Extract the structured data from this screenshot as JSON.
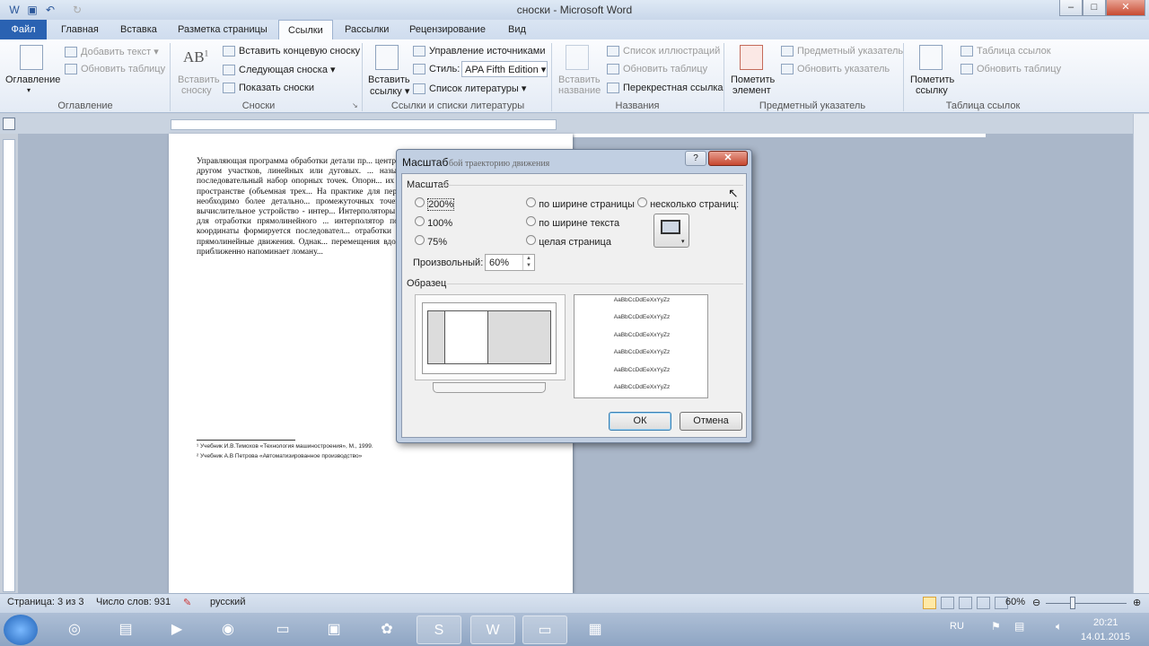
{
  "window": {
    "title": "сноски - Microsoft Word",
    "min": "–",
    "max": "□",
    "close": "✕"
  },
  "tabs": [
    "Файл",
    "Главная",
    "Вставка",
    "Разметка страницы",
    "Ссылки",
    "Рассылки",
    "Рецензирование",
    "Вид"
  ],
  "ribbon": {
    "toc": {
      "big": "Оглавление",
      "add_text": "Добавить текст",
      "update": "Обновить таблицу",
      "label": "Оглавление"
    },
    "footnotes": {
      "insert_big_1": "Вставить",
      "insert_big_2": "сноску",
      "endnote": "Вставить концевую сноску",
      "next": "Следующая сноска",
      "show": "Показать сноски",
      "label": "Сноски"
    },
    "citations": {
      "insert_big_1": "Вставить",
      "insert_big_2": "ссылку",
      "manage": "Управление источниками",
      "style_label": "Стиль:",
      "style_value": "APA Fifth Edition",
      "biblio": "Список литературы",
      "label": "Ссылки и списки литературы"
    },
    "captions": {
      "insert_big_1": "Вставить",
      "insert_big_2": "название",
      "list": "Список иллюстраций",
      "update": "Обновить таблицу",
      "cross": "Перекрестная ссылка",
      "label": "Названия"
    },
    "index": {
      "mark_big_1": "Пометить",
      "mark_big_2": "элемент",
      "insert": "Предметный указатель",
      "update": "Обновить указатель",
      "label": "Предметный указатель"
    },
    "toa": {
      "mark_big_1": "Пометить",
      "mark_big_2": "ссылку",
      "insert": "Таблица ссылок",
      "update": "Обновить таблицу",
      "label": "Таблица ссылок"
    }
  },
  "document": {
    "paragraph": "Управляющая программа обработки детали пр... центра фрезы. Траектория движения состоит из... другом участков, линейных или дуговых. ... называются опорными. В действительность... последовательный набор опорных точек. Опорн... их задания используется две координаты (д... пространстве (объемная трех... На практике для перемещения инструмента ... опорных точек, необходимо более детально... промежуточных точек и выдачи команд движ... специальное вычислительное устройство - интер... Интерполяторы делятся на линейные и кру... используется для отработки прямолинейного ... интерполятор поступает информация о коорди... каждой координаты формируется последовател... отработки заданной геометрии. Линейный ... только прямолинейные движения. Однак... перемещения вдоль заданной прямой достат... перемещения приближенно напоминает ломану...",
    "footnote1": "¹ Учебник И.В.Тимохов  «Технология машиностроения», М., 1999.",
    "footnote2": "² Учебник А.В Петрова «Автоматизированное  производство»"
  },
  "dialog": {
    "title": "Масштаб",
    "behind_title_text": "бой траекторию движения",
    "help": "?",
    "close": "✕",
    "zoom_group": "Масштаб",
    "r200": "200%",
    "r100": "100%",
    "r75": "75%",
    "page_width": "по ширине страницы",
    "text_width": "по ширине текста",
    "whole_page": "целая страница",
    "many_pages": "несколько страниц:",
    "percent_label": "Произвольный:",
    "percent_value": "60%",
    "preview_group": "Образец",
    "sample_text": "AaBbCcDdEeXxYyZz",
    "ok": "ОК",
    "cancel": "Отмена"
  },
  "status": {
    "page": "Страница: 3 из 3",
    "words": "Число слов: 931",
    "lang": "русский",
    "zoom": "60%"
  },
  "taskbar": {
    "lang": "RU",
    "time": "20:21",
    "date": "14.01.2015"
  }
}
